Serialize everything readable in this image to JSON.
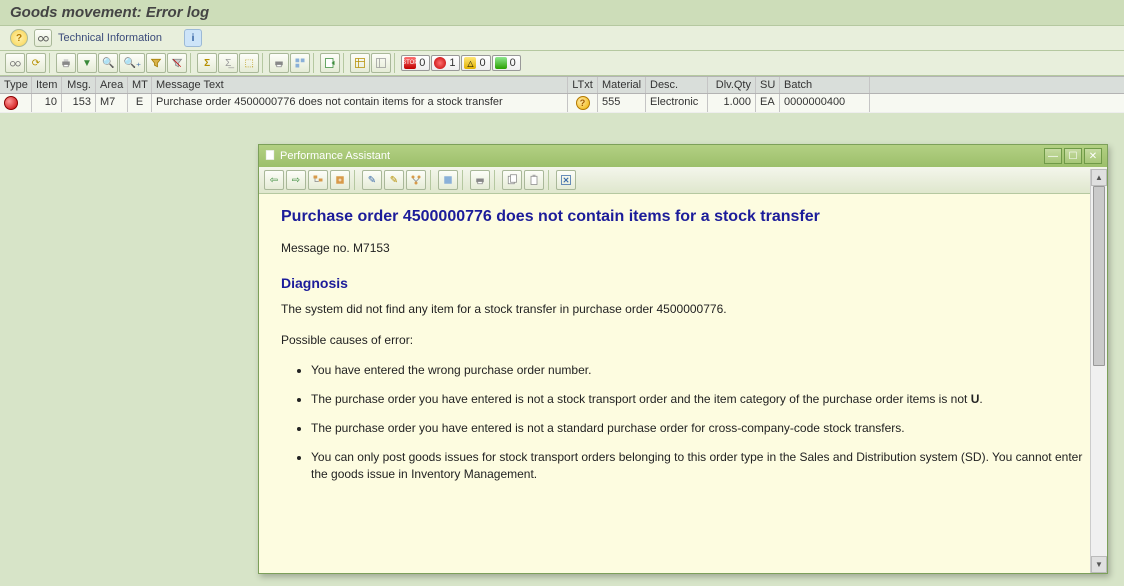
{
  "title": "Goods movement: Error log",
  "app_toolbar": {
    "technical_info": "Technical Information"
  },
  "status_counts": {
    "stop": "0",
    "error": "1",
    "warning": "0",
    "success": "0"
  },
  "grid": {
    "headers": {
      "type": "Type",
      "item": "Item",
      "msg": "Msg.",
      "area": "Area",
      "mt": "MT",
      "text": "Message Text",
      "ltxt": "LTxt",
      "material": "Material",
      "desc": "Desc.",
      "qty": "Dlv.Qty",
      "su": "SU",
      "batch": "Batch"
    },
    "rows": [
      {
        "type": "error",
        "item": "10",
        "msg": "153",
        "area": "M7",
        "mt": "E",
        "text": "Purchase order 4500000776 does not contain items for a stock transfer",
        "material": "555",
        "desc": "Electronic",
        "qty": "1.000",
        "su": "EA",
        "batch": "0000000400"
      }
    ]
  },
  "dialog": {
    "title": "Performance Assistant",
    "heading": "Purchase order 4500000776 does not contain items for a stock transfer",
    "message_no": "Message no. M7153",
    "diag_title": "Diagnosis",
    "diag_text": "The system did not find any item for a stock transfer in purchase order 4500000776.",
    "causes_title": "Possible causes of error:",
    "causes": [
      "You have entered the wrong purchase order number.",
      "The purchase order you have entered is not a stock transport order and the item category of the purchase order items is not <b>U</b>.",
      "The purchase order you have entered is not a standard purchase order for cross-company-code stock transfers.",
      "You can only post goods issues for stock transport orders belonging to this order type in the Sales and Distribution system (SD). You cannot enter the goods issue in Inventory Management."
    ]
  }
}
